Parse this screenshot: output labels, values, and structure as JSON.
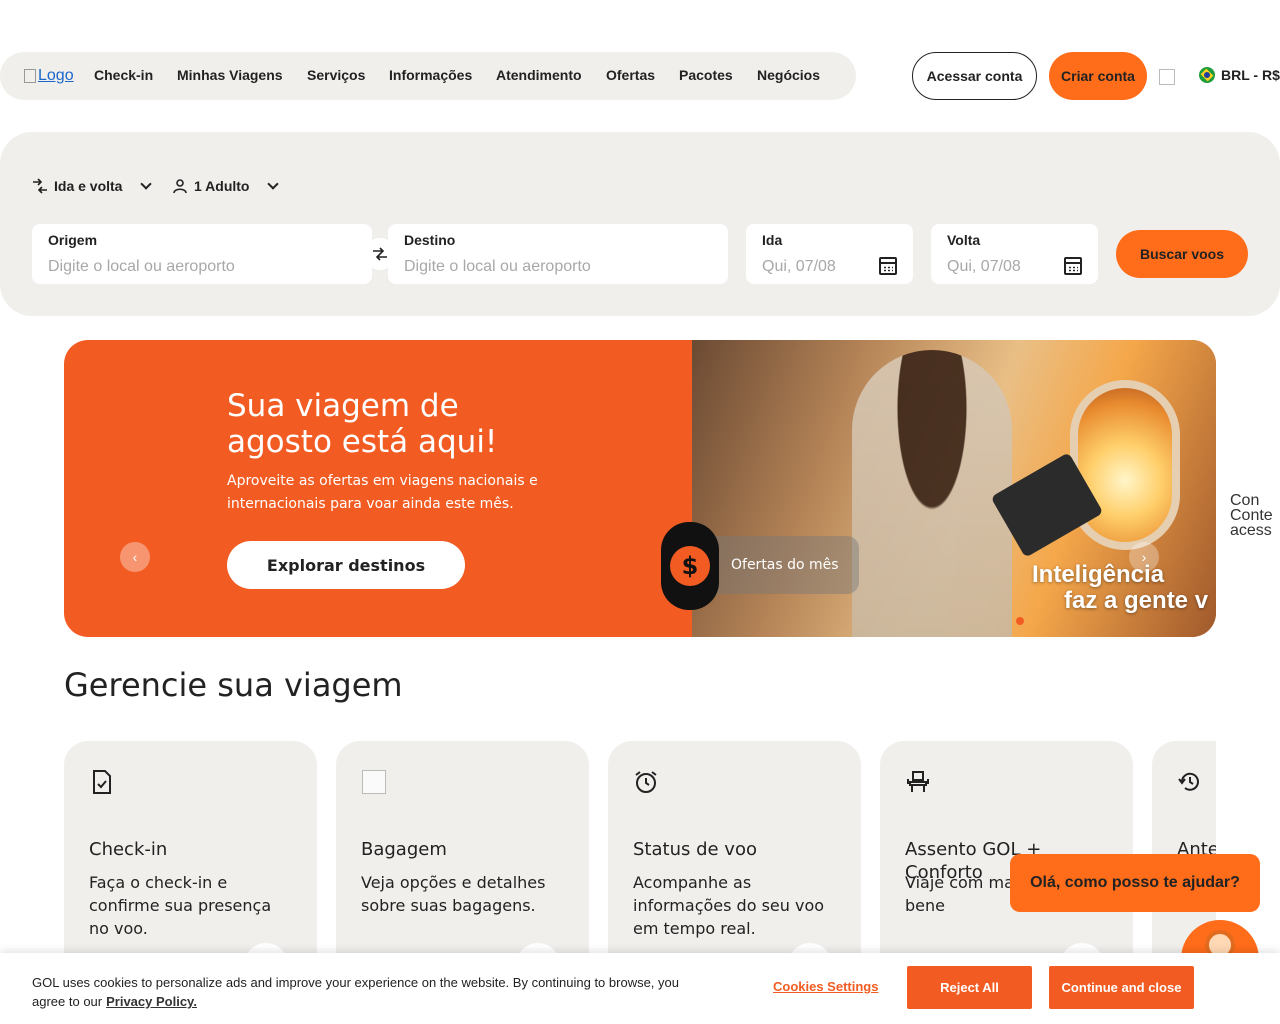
{
  "header": {
    "logo_alt": "Logo",
    "nav": [
      "Check-in",
      "Minhas Viagens",
      "Serviços",
      "Informações",
      "Atendimento",
      "Ofertas",
      "Pacotes",
      "Negócios"
    ],
    "login_label": "Acessar conta",
    "signup_label": "Criar conta",
    "currency_label": "BRL - R$"
  },
  "search": {
    "trip_type": "Ida e volta",
    "passengers": "1 Adulto",
    "origin_label": "Origem",
    "origin_placeholder": "Digite o local ou aeroporto",
    "destination_label": "Destino",
    "destination_placeholder": "Digite o local ou aeroporto",
    "depart_label": "Ida",
    "depart_placeholder": "Qui, 07/08",
    "return_label": "Volta",
    "return_placeholder": "Qui, 07/08",
    "submit_label": "Buscar voos"
  },
  "hero": {
    "title": "Sua viagem de agosto está aqui!",
    "subtitle": "Aproveite as ofertas em viagens nacionais e internacionais para voar ainda este mês.",
    "cta": "Explorar destinos",
    "badge_label": "Ofertas do mês",
    "overlay_line1": "Inteligência",
    "overlay_line2": "faz a gente v",
    "arrow_prev": "‹",
    "arrow_next": "›"
  },
  "side_image_alt": "Con Conte acess",
  "manage": {
    "title": "Gerencie sua viagem",
    "cards": [
      {
        "title": "Check-in",
        "desc": "Faça o check-in e confirme sua presença no voo.",
        "icon": "document-check-icon"
      },
      {
        "title": "Bagagem",
        "desc": "Veja opções e detalhes sobre suas bagagens.",
        "icon": "broken-image"
      },
      {
        "title": "Status de voo",
        "desc": "Acompanhe as informações do seu voo em tempo real.",
        "icon": "alarm-clock-icon"
      },
      {
        "title": "Assento GOL + Conforto",
        "desc": "Viaje com ma diversos bene",
        "icon": "seat-icon"
      },
      {
        "title": "Ante",
        "desc": "",
        "icon": "history-icon"
      }
    ]
  },
  "chat": {
    "greeting": "Olá, como posso te ajudar?"
  },
  "cookies": {
    "text": "GOL uses cookies to personalize ads and improve your experience on the website. By continuing to browse, you agree to our",
    "policy_link": "Privacy Policy.",
    "settings_label": "Cookies Settings",
    "reject_label": "Reject All",
    "accept_label": "Continue and close"
  },
  "colors": {
    "brand_orange": "#ff6c1a",
    "hero_orange": "#f25c22",
    "panel_gray": "#f1efec"
  }
}
